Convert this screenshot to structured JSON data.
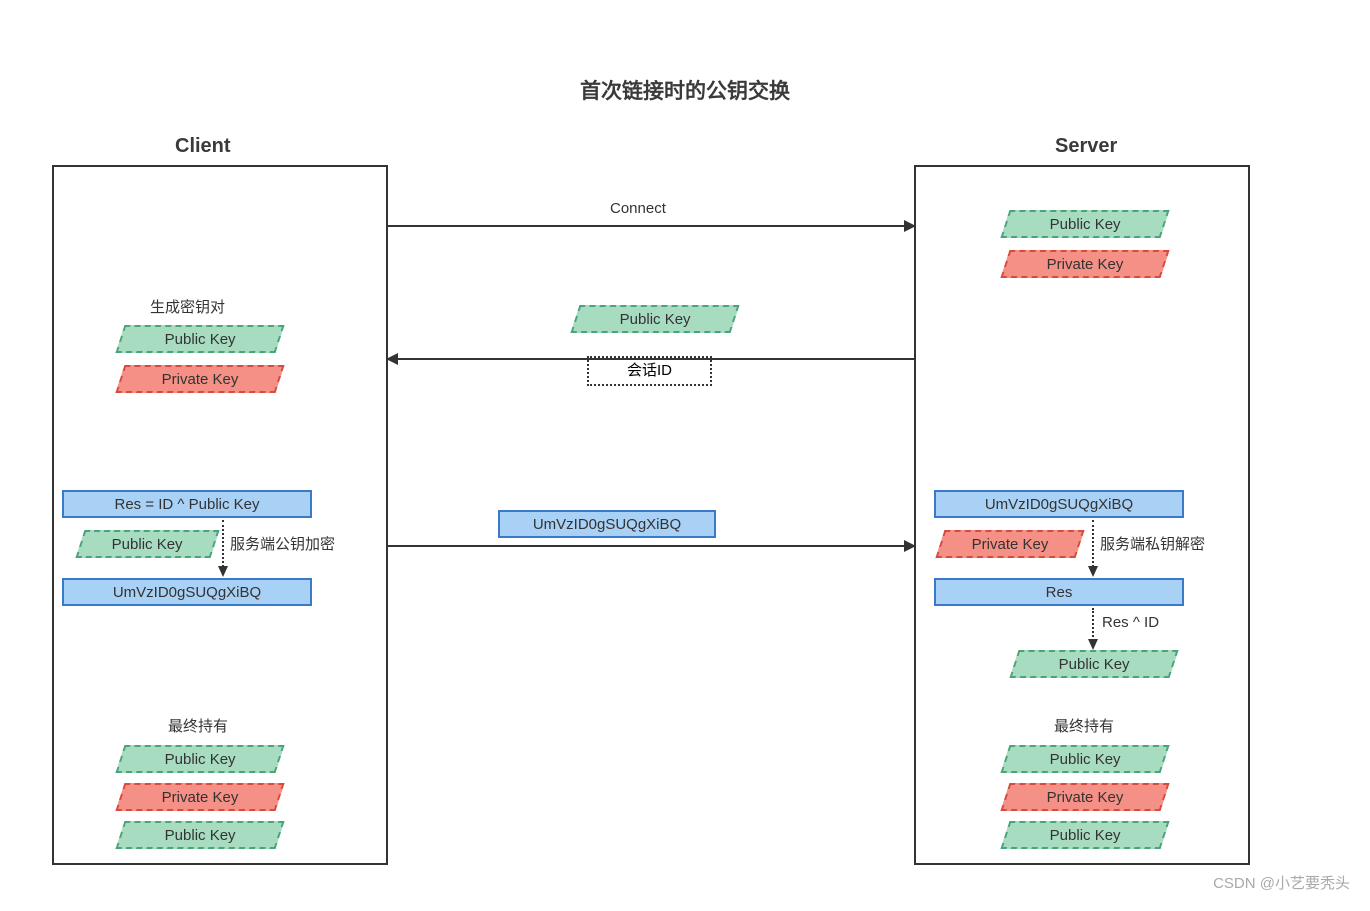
{
  "title": "首次链接时的公钥交换",
  "client_label": "Client",
  "server_label": "Server",
  "labels": {
    "public_key": "Public Key",
    "private_key": "Private Key",
    "session_id": "会话ID",
    "gen_keypair": "生成密钥对",
    "connect": "Connect",
    "res_formula": "Res = ID ^ Public Key",
    "encoded": "UmVzID0gSUQgXiBQ",
    "server_pub_encrypt": "服务端公钥加密",
    "server_priv_decrypt": "服务端私钥解密",
    "res": "Res",
    "res_xor_id": "Res ^ ID",
    "final_hold": "最终持有"
  },
  "watermark": "CSDN @小艺要秃头"
}
